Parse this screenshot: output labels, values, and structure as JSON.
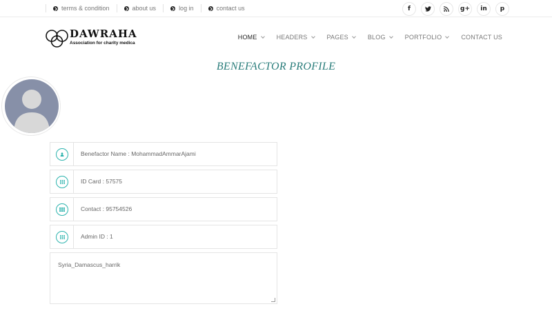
{
  "topbar": {
    "links": [
      {
        "label": "terms & condition",
        "icon": "arrow-circle-icon"
      },
      {
        "label": "about us",
        "icon": "arrow-circle-icon"
      },
      {
        "label": "log in",
        "icon": "arrow-circle-icon"
      },
      {
        "label": "contact us",
        "icon": "arrow-circle-icon"
      }
    ],
    "social": [
      {
        "icon": "facebook-icon",
        "glyph": "f"
      },
      {
        "icon": "twitter-icon",
        "glyph": "t"
      },
      {
        "icon": "rss-icon",
        "glyph": "≈"
      },
      {
        "icon": "google-plus-icon",
        "glyph": "g+"
      },
      {
        "icon": "linkedin-icon",
        "glyph": "in"
      },
      {
        "icon": "pinterest-icon",
        "glyph": "p"
      }
    ]
  },
  "logo": {
    "title": "DAWRAHA",
    "subtitle": "Association for charity medica"
  },
  "nav": {
    "items": [
      {
        "label": "HOME",
        "dropdown": true,
        "active": true
      },
      {
        "label": "HEADERS",
        "dropdown": true
      },
      {
        "label": "PAGES",
        "dropdown": true
      },
      {
        "label": "BLOG",
        "dropdown": true
      },
      {
        "label": "PORTFOLIO",
        "dropdown": true
      },
      {
        "label": "CONTACT US",
        "dropdown": false
      }
    ]
  },
  "page": {
    "title": "BENEFACTOR PROFILE"
  },
  "profile": {
    "fields": [
      {
        "label": "Benefactor Name : MohammadAmmarAjami",
        "icon": "user-icon"
      },
      {
        "label": "ID Card : 57575",
        "icon": "grid-icon"
      },
      {
        "label": "Contact : 95754526",
        "icon": "table-icon"
      },
      {
        "label": "Admin ID : 1",
        "icon": "grid-icon"
      }
    ],
    "address": "Syria_Damascus_harrik"
  },
  "colors": {
    "accent": "#2a7d7b",
    "icon_ring": "#2bb3ad",
    "avatar_bg": "#8790a8"
  }
}
